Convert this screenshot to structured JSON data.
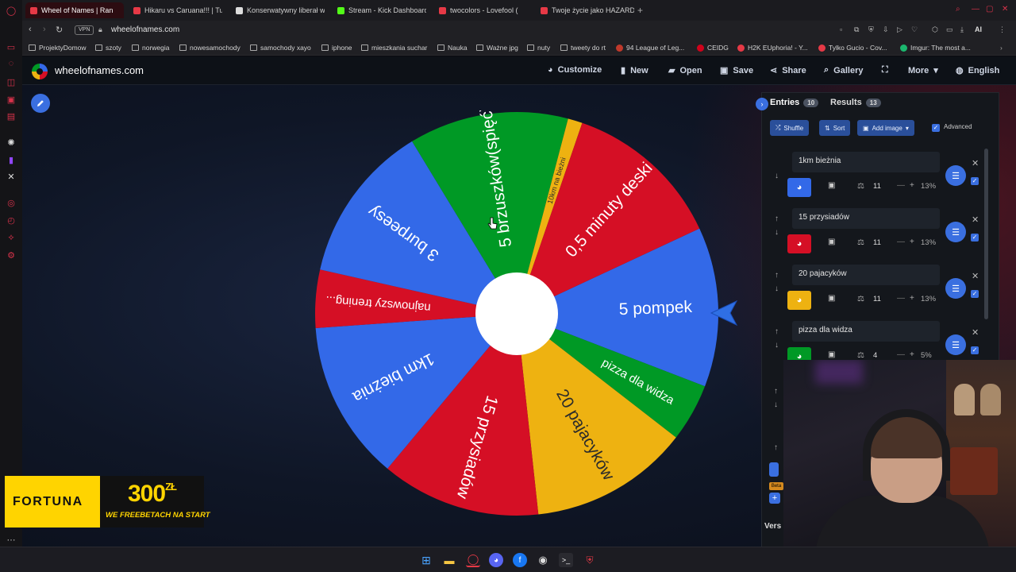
{
  "browser": {
    "tabs": [
      {
        "label": "Wheel of Names | Ran",
        "active": true,
        "color": "#e63946"
      },
      {
        "label": "Hikaru vs Caruana!!! | Tur",
        "active": false,
        "color": "#e63946"
      },
      {
        "label": "Konserwatywny liberał w",
        "active": false,
        "color": "#dddddd"
      },
      {
        "label": "Stream - Kick Dashboard",
        "active": false,
        "color": "#53fc18"
      },
      {
        "label": "twocolors - Lovefool (",
        "active": false,
        "color": "#e63946"
      },
      {
        "label": "Twoje życie jako HAZARD",
        "active": false,
        "color": "#e63946"
      }
    ],
    "vpn_label": "VPN",
    "url": "wheelofnames.com",
    "ai_label": "AI",
    "bookmarks": [
      {
        "label": "ProjektyDomow",
        "kind": "folder"
      },
      {
        "label": "szoty",
        "kind": "folder"
      },
      {
        "label": "norwegia",
        "kind": "folder"
      },
      {
        "label": "nowesamochody",
        "kind": "folder"
      },
      {
        "label": "samochody xayo",
        "kind": "folder"
      },
      {
        "label": "iphone",
        "kind": "folder"
      },
      {
        "label": "mieszkania suchar",
        "kind": "folder"
      },
      {
        "label": "Nauka",
        "kind": "folder"
      },
      {
        "label": "Ważne jpg",
        "kind": "folder"
      },
      {
        "label": "nuty",
        "kind": "folder"
      },
      {
        "label": "tweety do rt",
        "kind": "folder"
      },
      {
        "label": "94 League of Leg...",
        "kind": "site",
        "color": "#c0392b"
      },
      {
        "label": "CEIDG",
        "kind": "site",
        "color": "#d0021b"
      },
      {
        "label": "H2K EUphoria! - Y...",
        "kind": "site",
        "color": "#e63946"
      },
      {
        "label": "Tylko Gucio - Cov...",
        "kind": "site",
        "color": "#e63946"
      },
      {
        "label": "Imgur: The most a...",
        "kind": "site",
        "color": "#1bb76e"
      }
    ]
  },
  "site": {
    "name": "wheelofnames.com",
    "header_buttons": [
      {
        "label": "Customize",
        "icon": "palette-icon"
      },
      {
        "label": "New",
        "icon": "file-icon"
      },
      {
        "label": "Open",
        "icon": "folder-open-icon"
      },
      {
        "label": "Save",
        "icon": "save-icon"
      },
      {
        "label": "Share",
        "icon": "share-icon"
      },
      {
        "label": "Gallery",
        "icon": "search-icon"
      },
      {
        "label": "",
        "icon": "fullscreen-icon"
      },
      {
        "label": "More",
        "icon": "chevron-down-icon"
      },
      {
        "label": "English",
        "icon": "globe-icon"
      }
    ]
  },
  "wheel": {
    "colors": {
      "blue": "#3369e8",
      "red": "#d50f25",
      "yellow": "#eeb211",
      "green": "#009925"
    },
    "segments": [
      {
        "label": "5 pompek",
        "color": "#3369e8",
        "weight": 11
      },
      {
        "label": "pizza dla widza",
        "color": "#009925",
        "weight": 4
      },
      {
        "label": "20 pajacyków",
        "color": "#eeb211",
        "weight": 11
      },
      {
        "label": "15 przysiadów",
        "color": "#d50f25",
        "weight": 11
      },
      {
        "label": "1km bieżnia",
        "color": "#3369e8",
        "weight": 11
      },
      {
        "label": "najnowszy trening...",
        "color": "#d50f25",
        "weight": 4
      },
      {
        "label": "3 burpeesy",
        "color": "#3369e8",
        "weight": 11
      },
      {
        "label": "5 brzuszków(spięć)",
        "color": "#009925",
        "weight": 11
      },
      {
        "label": "10km na bieżni",
        "color": "#eeb211",
        "weight": 1
      },
      {
        "label": "0,5 minuty deski",
        "color": "#d50f25",
        "weight": 11
      }
    ]
  },
  "panel": {
    "entries_tab": "Entries",
    "entries_count": "10",
    "results_tab": "Results",
    "results_count": "13",
    "shuffle_label": "Shuffle",
    "sort_label": "Sort",
    "add_image_label": "Add image",
    "advanced_label": "Advanced",
    "entries": [
      {
        "name": "1km bieżnia",
        "color": "#3369e8",
        "weight": "11",
        "percent": "13%",
        "show_up": false
      },
      {
        "name": "15 przysiadów",
        "color": "#d50f25",
        "weight": "11",
        "percent": "13%",
        "show_up": true
      },
      {
        "name": "20 pajacyków",
        "color": "#eeb211",
        "weight": "11",
        "percent": "13%",
        "show_up": true
      },
      {
        "name": "pizza dla widza",
        "color": "#009925",
        "weight": "4",
        "percent": "5%",
        "show_up": true
      }
    ],
    "version_label": "Vers",
    "beta_label": "Beta"
  },
  "ad": {
    "brand": "FORTUNA",
    "amount": "300",
    "currency": "ZŁ",
    "subtitle": "WE FREEBETACH NA START"
  }
}
